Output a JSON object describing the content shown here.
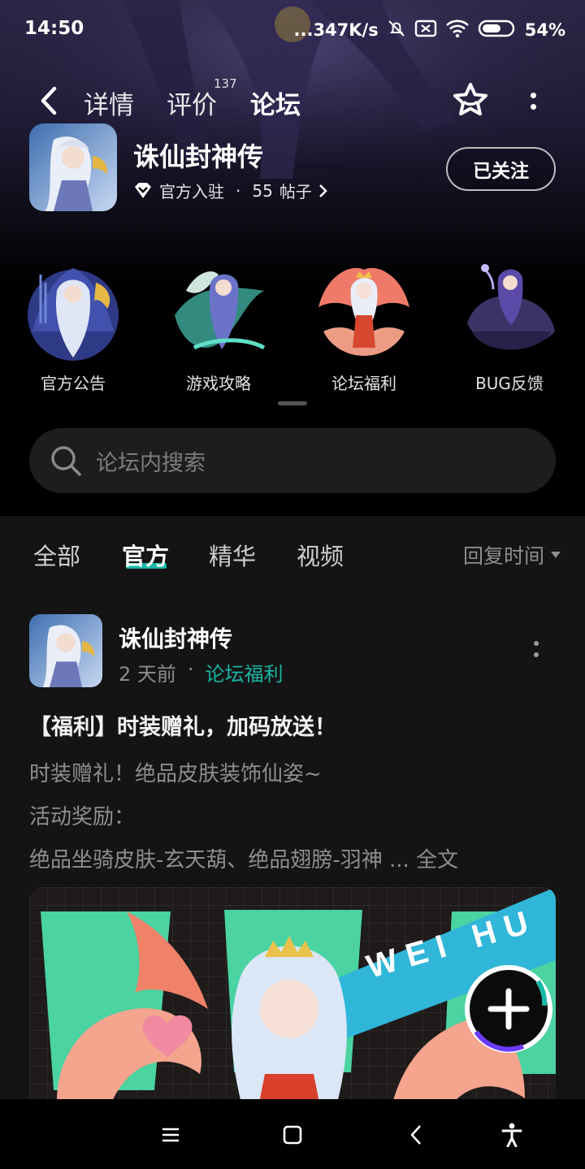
{
  "status": {
    "time": "14:50",
    "net_speed": "...347K/s",
    "battery": "54%"
  },
  "nav": {
    "tabs": [
      {
        "label": "详情"
      },
      {
        "label": "评价",
        "badge": "137"
      },
      {
        "label": "论坛"
      }
    ],
    "active_tab": "论坛"
  },
  "game": {
    "title": "诛仙封神传",
    "official_label": "官方入驻",
    "separator": "·",
    "posts_count": "55",
    "posts_label": "帖子",
    "follow_label": "已关注"
  },
  "categories": [
    {
      "label": "官方公告"
    },
    {
      "label": "游戏攻略"
    },
    {
      "label": "论坛福利"
    },
    {
      "label": "BUG反馈"
    }
  ],
  "search": {
    "placeholder": "论坛内搜索"
  },
  "filters": {
    "tabs": [
      {
        "label": "全部"
      },
      {
        "label": "官方"
      },
      {
        "label": "精华"
      },
      {
        "label": "视频"
      }
    ],
    "active": "官方",
    "sort_label": "回复时间"
  },
  "post": {
    "author": "诛仙封神传",
    "time": "2 天前",
    "separator": "·",
    "forum": "论坛福利",
    "title": "【福利】时装赠礼，加码放送！",
    "lines": [
      "时装赠礼！绝品皮肤装饰仙姿~",
      "活动奖励：",
      "绝品坐骑皮肤-玄天葫、绝品翅膀-羽神 ..."
    ],
    "fulltext_label": "全文",
    "banner_text": "WEI HU"
  },
  "colors": {
    "accent": "#17b8a6",
    "background": "#000000",
    "feed_background": "#141414",
    "muted_text": "#8e8e91"
  }
}
